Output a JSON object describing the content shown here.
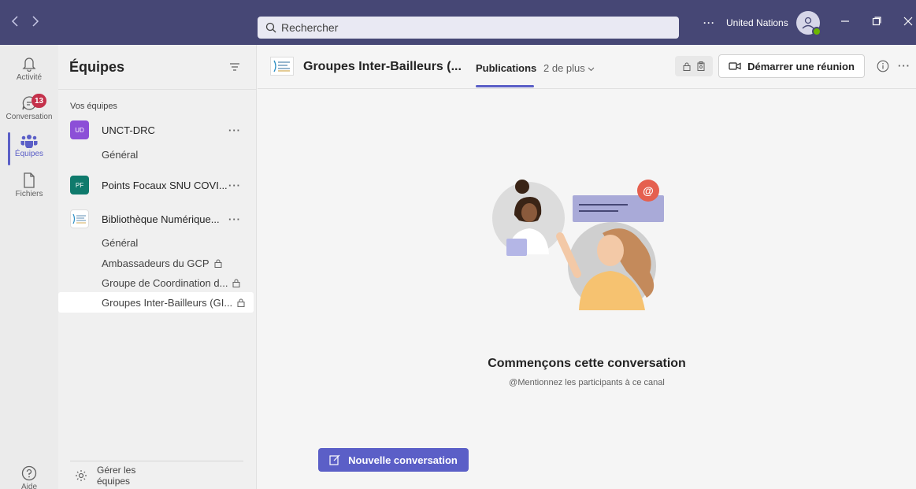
{
  "titlebar": {
    "back_icon": "chevron-left",
    "forward_icon": "chevron-right",
    "search_placeholder": "Rechercher",
    "more": "···",
    "org_name": "United Nations"
  },
  "appbar": {
    "items": [
      {
        "label": "Activité",
        "icon": "bell-icon"
      },
      {
        "label": "Conversation",
        "icon": "chat-icon",
        "badge": "13"
      },
      {
        "label": "Équipes",
        "icon": "teams-icon"
      },
      {
        "label": "Fichiers",
        "icon": "file-icon"
      }
    ],
    "help_label": "Aide"
  },
  "panel": {
    "title": "Équipes",
    "section_label": "Vos équipes",
    "teams": [
      {
        "initials": "UD",
        "name": "UNCT-DRC",
        "color": "#8c4fd7"
      },
      {
        "initials": "PF",
        "name": "Points Focaux SNU COVI...",
        "color": "#0f7a6c"
      },
      {
        "initials": "",
        "name": "Bibliothèque Numérique...",
        "color": "#ffffff"
      }
    ],
    "channels": {
      "unct_general": "Général",
      "bib_general": "Général",
      "ambassadeurs": "Ambassadeurs du GCP",
      "coordination": "Groupe de Coordination d...",
      "inter_bailleurs": "Groupes Inter-Bailleurs (GI..."
    },
    "more": "···",
    "manage_line1": "Gérer les",
    "manage_line2": "équipes"
  },
  "main": {
    "channel_title": "Groupes Inter-Bailleurs (...",
    "tab_publications": "Publications",
    "tab_more": "2 de plus",
    "meet_button": "Démarrer une réunion",
    "more": "···",
    "empty_title": "Commençons cette conversation",
    "empty_subtitle": "@Mentionnez les participants à ce canal",
    "new_conversation": "Nouvelle conversation"
  },
  "colors": {
    "titlebar": "#464775",
    "accent": "#5b5fc7",
    "badge": "#c4314b"
  }
}
